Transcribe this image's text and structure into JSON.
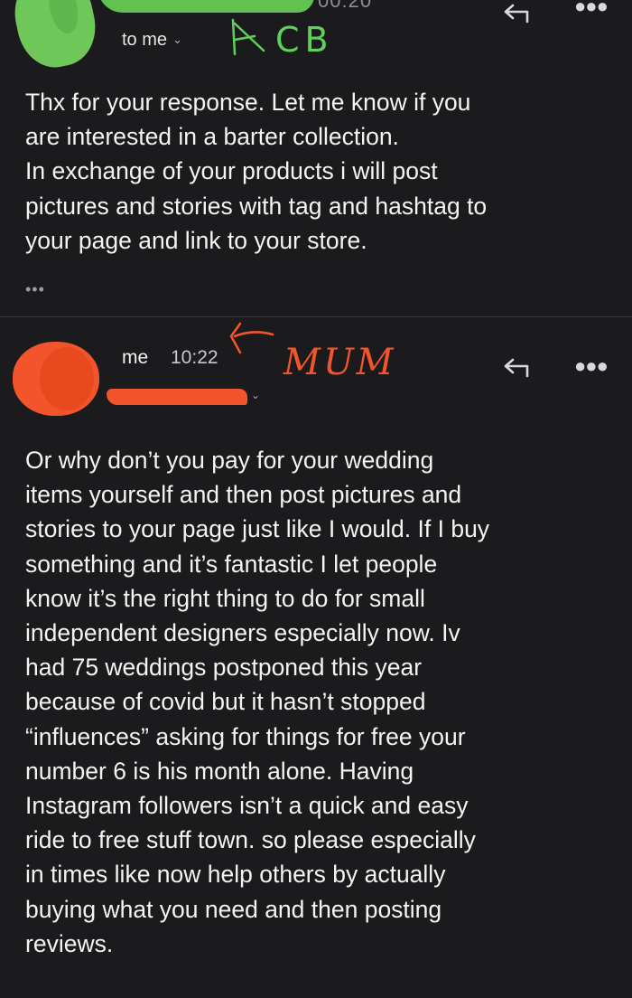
{
  "message1": {
    "time": "00:20",
    "recipient_label": "to me",
    "annotation": "CB",
    "body": [
      "Thx for your response.  Let me know if you",
      "are interested in a barter collection.",
      "In exchange of your products i will post",
      "pictures and stories with tag and hashtag to",
      "your page and link to your store."
    ],
    "ellipsis": "•••"
  },
  "message2": {
    "sender": "me",
    "time": "10:22",
    "annotation": "MUM",
    "body": [
      "Or why don’t you pay for your wedding",
      "items yourself and then post pictures and",
      "stories to your page just like I would. If I buy",
      "something and it’s fantastic I let people",
      "know it’s the right thing to do for small",
      "independent designers especially now. Iv",
      "had 75 weddings postponed this year",
      "because of covid but it hasn’t stopped",
      "“influences” asking for things for free your",
      "number 6 is his month alone. Having",
      "Instagram followers isn’t a quick and easy",
      "ride to free stuff town. so please especially",
      "in times like now help others by actually",
      "buying what you need and then posting",
      "reviews."
    ]
  },
  "icons": {
    "reply": "reply-icon",
    "more": "more-icon",
    "chevron": "chevron-down-icon"
  },
  "colors": {
    "background": "#1b1b1d",
    "annotation_green": "#5fd05a",
    "annotation_red": "#f2552c"
  }
}
